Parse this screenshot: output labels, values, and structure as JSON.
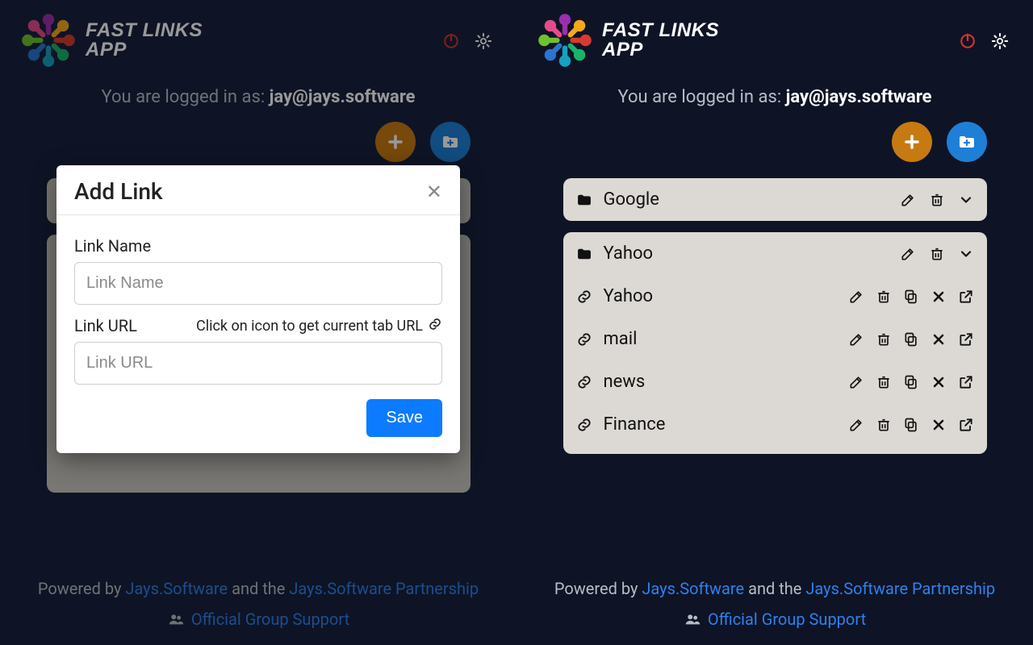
{
  "app": {
    "brand_line1": "FAST LINKS",
    "brand_line2": "APP"
  },
  "left": {
    "login_prefix": "You are logged in as: ",
    "login_user": "jay@jays.software",
    "modal": {
      "title": "Add Link",
      "label_name": "Link Name",
      "placeholder_name": "Link Name",
      "label_url": "Link URL",
      "hint_url": "Click on icon to get current tab URL",
      "placeholder_url": "Link URL",
      "save": "Save"
    }
  },
  "right": {
    "login_prefix": "You are logged in as: ",
    "login_user": "jay@jays.software",
    "groups": [
      {
        "name": "Google",
        "expanded": false,
        "links": []
      },
      {
        "name": "Yahoo",
        "expanded": true,
        "links": [
          {
            "name": "Yahoo"
          },
          {
            "name": "mail"
          },
          {
            "name": "news"
          },
          {
            "name": "Finance"
          }
        ]
      }
    ]
  },
  "footer": {
    "powered_prefix": "Powered by ",
    "link1": "Jays.Software",
    "mid": " and the ",
    "link2": "Jays.Software Partnership",
    "support": "Official Group Support"
  }
}
